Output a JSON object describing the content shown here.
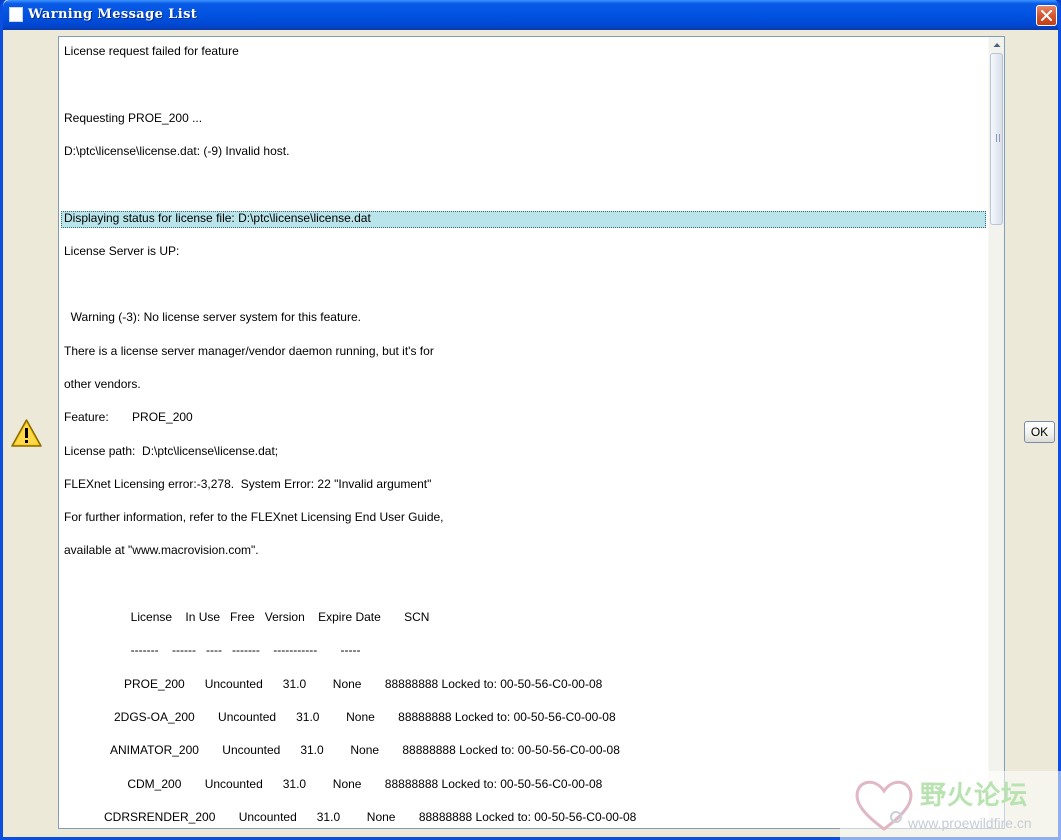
{
  "window": {
    "title": "Warning Message List"
  },
  "icons": {
    "app": "app-window-icon",
    "close": "close-icon",
    "warning": "warning-triangle-icon",
    "scroll_up": "arrow-up-icon",
    "watermark_logo": "heart-logo-icon"
  },
  "colors": {
    "titlebar": "#0053e1",
    "close_button": "#d65a34",
    "window_face": "#ece9d8",
    "selection": "#b8e4ea",
    "panel_border": "#7f9db9",
    "warning_yellow": "#f5c400"
  },
  "messages": [
    "License request failed for feature",
    "",
    "Requesting PROE_200 ...",
    "D:\\ptc\\license\\license.dat: (-9) Invalid host.",
    "",
    "Displaying status for license file: D:\\ptc\\license\\license.dat",
    "License Server is UP:",
    "",
    "  Warning (-3): No license server system for this feature.",
    "There is a license server manager/vendor daemon running, but it's for",
    "other vendors.",
    "Feature:       PROE_200",
    "License path:  D:\\ptc\\license\\license.dat;",
    "FLEXnet Licensing error:-3,278.  System Error: 22 \"Invalid argument\"",
    "For further information, refer to the FLEXnet Licensing End User Guide,",
    "available at \"www.macrovision.com\".",
    "",
    "                    License    In Use   Free   Version    Expire Date       SCN",
    "                    -------    ------   ----   -------    -----------       -----",
    "                  PROE_200      Uncounted      31.0        None       88888888 Locked to: 00-50-56-C0-00-08",
    "               2DGS-OA_200       Uncounted      31.0        None       88888888 Locked to: 00-50-56-C0-00-08",
    "              ANIMATOR_200       Uncounted      31.0        None       88888888 Locked to: 00-50-56-C0-00-08",
    "                   CDM_200       Uncounted      31.0        None       88888888 Locked to: 00-50-56-C0-00-08",
    "            CDRSRENDER_200       Uncounted      31.0        None       88888888 Locked to: 00-50-56-C0-00-08"
  ],
  "selected_index": 5,
  "ok_button": {
    "label": "OK"
  },
  "watermark": {
    "site_name": "野火论坛",
    "url": "www.proewildfire.cn"
  }
}
